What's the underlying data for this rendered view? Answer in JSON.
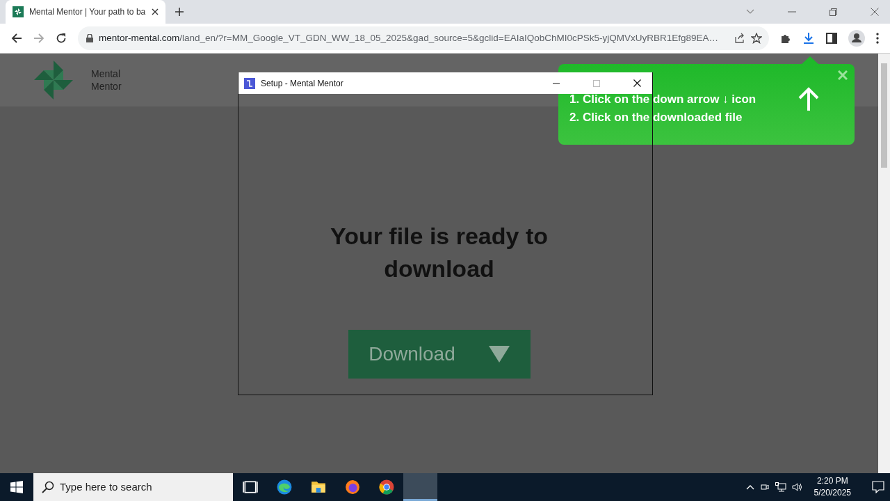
{
  "browser": {
    "tab": {
      "title": "Mental Mentor | Your path to ba",
      "selected": true
    },
    "address": {
      "domain": "mentor-mental.com",
      "path": "/land_en/?r=MM_Google_VT_GDN_WW_18_05_2025&gad_source=5&gclid=EAIaIQobChMI0cPSk5-yjQMVxUyRBR1Efg89EA…"
    }
  },
  "page": {
    "brand": "Mental Mentor",
    "heading": "Your file is ready to download",
    "download_button": "Download"
  },
  "setup_window": {
    "title": "Setup - Mental Mentor"
  },
  "hint_popup": {
    "steps": [
      "1. Click on the down arrow ↓ icon",
      "2. Click on the downloaded file"
    ]
  },
  "taskbar": {
    "search": {
      "placeholder": "Type here to search"
    },
    "apps": [
      {
        "kind": "taskview",
        "selected": false
      },
      {
        "kind": "edge",
        "selected": false
      },
      {
        "kind": "explorer",
        "selected": false
      },
      {
        "kind": "firefox",
        "selected": false
      },
      {
        "kind": "chrome",
        "selected": false
      },
      {
        "kind": "blank",
        "selected": true
      }
    ],
    "time": "2:20 PM",
    "date": "5/20/2025"
  }
}
